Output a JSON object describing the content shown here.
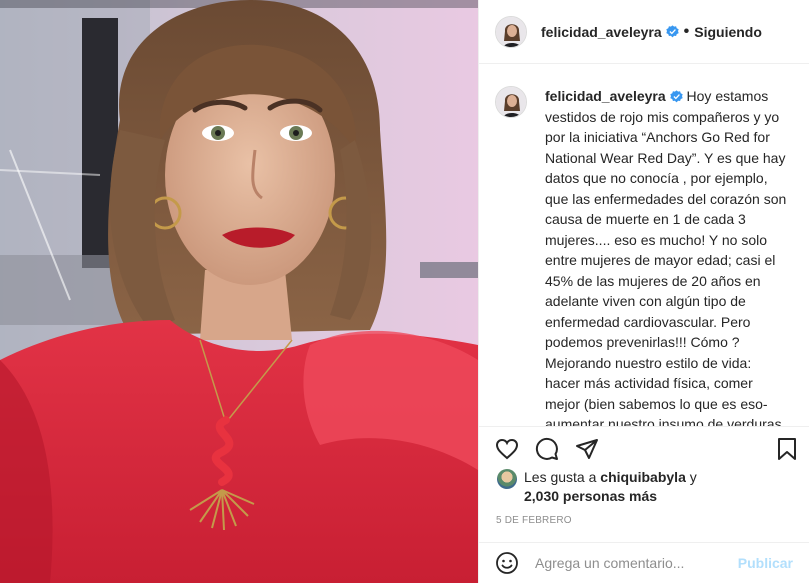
{
  "post": {
    "username": "felicidad_aveleyra",
    "follow_status": "Siguiendo",
    "separator": "•",
    "caption": "Hoy estamos vestidos de rojo mis compañeros y yo por la iniciativa “Anchors Go Red for National Wear Red Day”. Y es que hay datos que no conocía , por ejemplo, que las enfermedades del corazón son causa de muerte en 1 de cada 3 mujeres.... eso es mucho! Y no solo entre mujeres de mayor edad; casi el 45% de las mujeres de 20 años en adelante viven con algún tipo de enfermedad cardiovascular. Pero podemos prevenirlas!!! Cómo ? Mejorando nuestro estilo de vida: hacer más actividad física, comer mejor (bien sabemos lo que es eso- aumentar nuestro insumo de verduras y reducir la comida procesada por ejemplo) y estar al tanto de nuestra",
    "likes": {
      "prefix": "Les gusta a",
      "liker": "chiquibabyla",
      "connector": "y",
      "others": "2,030 personas más"
    },
    "date": "5 DE FEBRERO"
  },
  "comment": {
    "placeholder": "Agrega un comentario...",
    "publish_label": "Publicar"
  },
  "icons": {
    "verified": "verified-badge-icon",
    "like": "heart-icon",
    "comment": "comment-bubble-icon",
    "share": "paper-plane-icon",
    "save": "bookmark-icon",
    "emoji": "smiley-icon"
  },
  "colors": {
    "verified_blue": "#3897f0",
    "publish_disabled": "#b2dffc",
    "dress_red": "#d8263a"
  }
}
